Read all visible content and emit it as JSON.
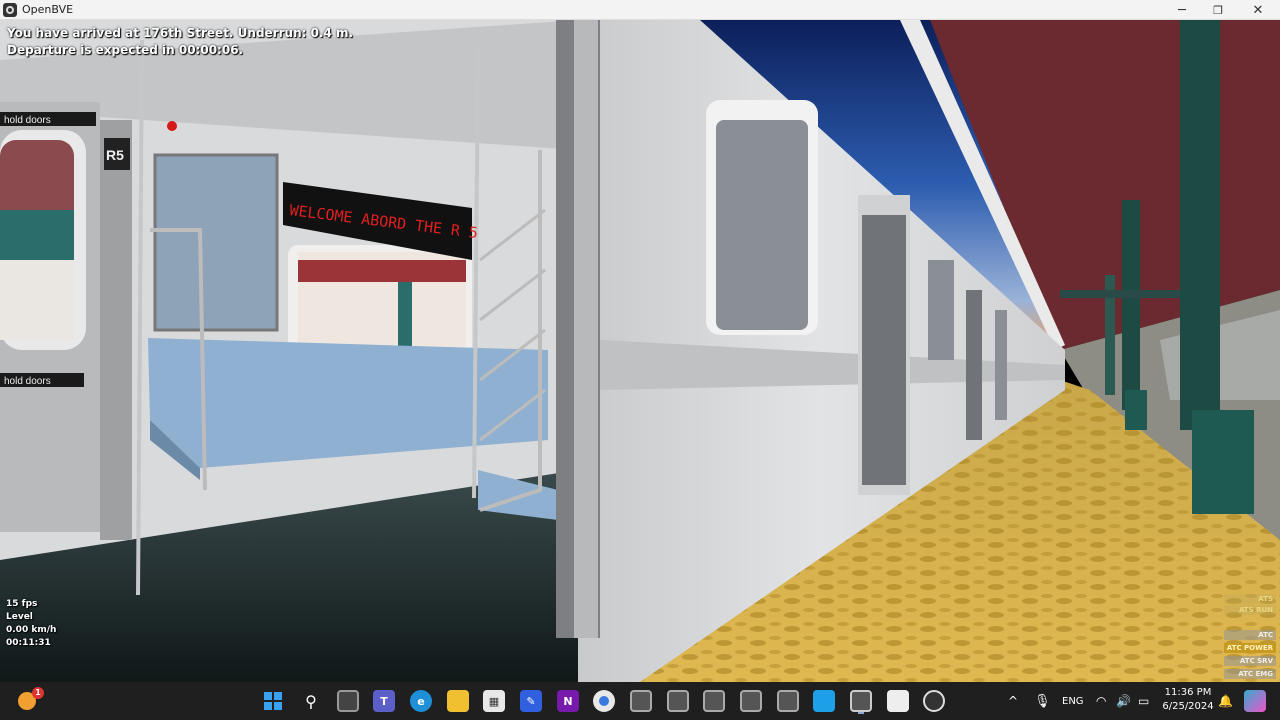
{
  "window": {
    "title": "OpenBVE",
    "app_icon": "openbve-icon",
    "controls": {
      "minimize": "─",
      "maximize": "❐",
      "close": "✕"
    }
  },
  "hud": {
    "message_line1": "You have arrived at 176th Street. Underrun: 0.4 m.",
    "message_line2": "Departure is expected in 00:00:06.",
    "fps": "15 fps",
    "gradient": "Level",
    "speed": "0.00 km/h",
    "time": "00:11:31"
  },
  "scene": {
    "door_sign": "hold doors",
    "car_number": "R5",
    "led_sign": "WELCOME ABORD THE R 5",
    "colors": {
      "sky": "#1c3c82",
      "canopy": "#6a2a30",
      "platform": "#d7b24a",
      "columns": "#1f5a52",
      "car_body": "#d7d8da",
      "seat": "#8fb0d0"
    }
  },
  "safety_panel": {
    "items": [
      {
        "label": "ATS",
        "state": "off"
      },
      {
        "label": "ATS RUN",
        "state": "off"
      },
      {
        "label": "ATC",
        "state": "grey"
      },
      {
        "label": "ATC POWER",
        "state": "on"
      },
      {
        "label": "ATC SRV",
        "state": "grey"
      },
      {
        "label": "ATC EMG",
        "state": "grey"
      }
    ]
  },
  "taskbar": {
    "weather_badge": "1",
    "apps": [
      {
        "name": "start",
        "icon": "windows-start-icon"
      },
      {
        "name": "search",
        "icon": "search-icon"
      },
      {
        "name": "task-view",
        "icon": "task-view-icon"
      },
      {
        "name": "teams",
        "icon": "teams-icon"
      },
      {
        "name": "edge",
        "icon": "edge-icon"
      },
      {
        "name": "file-explorer",
        "icon": "folder-icon"
      },
      {
        "name": "store",
        "icon": "store-icon"
      },
      {
        "name": "app-7",
        "icon": "pen-app-icon"
      },
      {
        "name": "onenote",
        "icon": "onenote-icon"
      },
      {
        "name": "chrome",
        "icon": "chrome-icon"
      },
      {
        "name": "openbve-1",
        "icon": "openbve-icon"
      },
      {
        "name": "openbve-2",
        "icon": "openbve-icon"
      },
      {
        "name": "openbve-3",
        "icon": "openbve-icon"
      },
      {
        "name": "openbve-4",
        "icon": "openbve-icon"
      },
      {
        "name": "openbve-5",
        "icon": "openbve-icon"
      },
      {
        "name": "app-16",
        "icon": "blue-app-icon"
      },
      {
        "name": "openbve-active",
        "icon": "openbve-icon"
      },
      {
        "name": "app-18",
        "icon": "white-app-icon"
      },
      {
        "name": "app-19",
        "icon": "recorder-icon"
      }
    ],
    "tray": {
      "chevron": "^",
      "language": "ENG",
      "clock_time": "11:36 PM",
      "clock_date": "6/25/2024"
    }
  }
}
